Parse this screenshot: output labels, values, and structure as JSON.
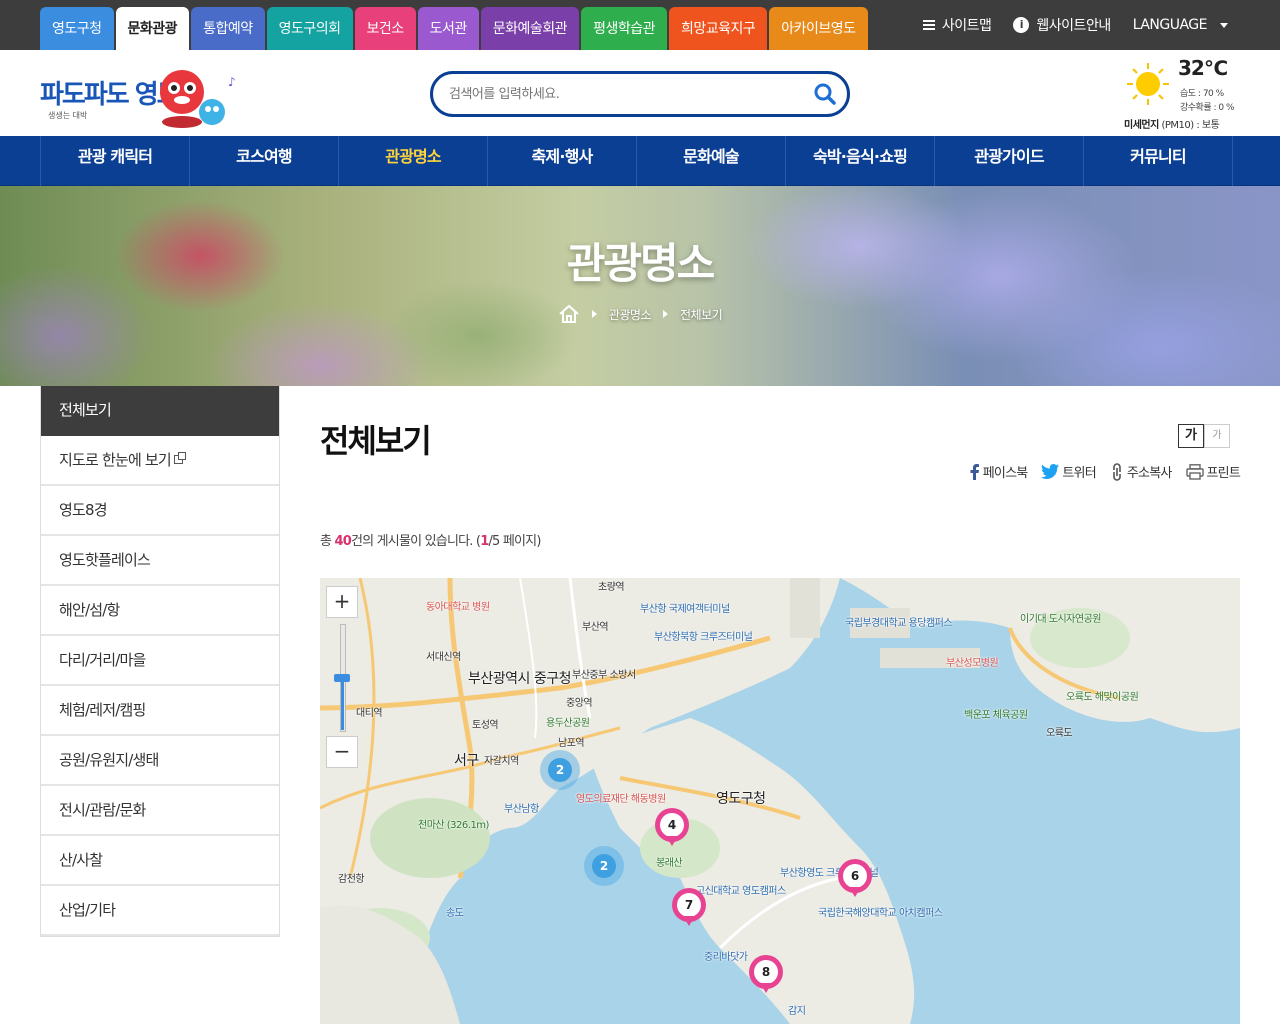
{
  "site_tabs": [
    {
      "label": "영도구청",
      "color": "#3b8de0"
    },
    {
      "label": "문화관광",
      "color": "#ffffff"
    },
    {
      "label": "통합예약",
      "color": "#4a6cc9"
    },
    {
      "label": "영도구의회",
      "color": "#14a3a0"
    },
    {
      "label": "보건소",
      "color": "#e8407a"
    },
    {
      "label": "도서관",
      "color": "#9b59d0"
    },
    {
      "label": "문화예술회관",
      "color": "#7a3fa8"
    },
    {
      "label": "평생학습관",
      "color": "#2eae4d"
    },
    {
      "label": "희망교육지구",
      "color": "#f0541e"
    },
    {
      "label": "아카이브영도",
      "color": "#e88a1a"
    }
  ],
  "util": {
    "sitemap": "사이트맵",
    "guide": "웹사이트안내",
    "language": "LANGUAGE"
  },
  "logo": {
    "text": "파도파도 영도",
    "sub": "생생는 대박"
  },
  "search": {
    "placeholder": "검색어를 입력하세요."
  },
  "weather": {
    "temp": "32℃",
    "humidity": "습도 : 70 %",
    "rain": "강수확률 : 0 %",
    "dust_label": "미세먼지",
    "dust_value": "(PM10) : 보통"
  },
  "gnb": [
    "관광 캐릭터",
    "코스여행",
    "관광명소",
    "축제·행사",
    "문화예술",
    "숙박·음식·쇼핑",
    "관광가이드",
    "커뮤니티"
  ],
  "banner": {
    "title": "관광명소",
    "crumb1": "관광명소",
    "crumb2": "전체보기"
  },
  "lnb": [
    "전체보기",
    "지도로 한눈에 보기",
    "영도8경",
    "영도핫플레이스",
    "해안/섬/항",
    "다리/거리/마을",
    "체험/레저/캠핑",
    "공원/유원지/생태",
    "전시/관람/문화",
    "산/사찰",
    "산업/기타"
  ],
  "content": {
    "title": "전체보기",
    "font_big": "가",
    "font_small": "가",
    "share": {
      "facebook": "페이스북",
      "twitter": "트위터",
      "copy": "주소복사",
      "print": "프린트"
    },
    "count_prefix": "총 ",
    "count_num": "40",
    "count_mid": "건의 게시물이 있습니다. (",
    "count_page": "1",
    "count_suffix": "/5 페이지)"
  },
  "map": {
    "zoom_in": "+",
    "zoom_out": "−",
    "labels": [
      {
        "text": "초량역",
        "cls": ""
      },
      {
        "text": "동아대학교 병원",
        "cls": "red"
      },
      {
        "text": "부산항 국제여객터미널",
        "cls": "blue"
      },
      {
        "text": "부산역",
        "cls": ""
      },
      {
        "text": "부산항북항 크루즈터미널",
        "cls": "blue"
      },
      {
        "text": "국립부경대학교 용당캠퍼스",
        "cls": "blue"
      },
      {
        "text": "이기대 도시자연공원",
        "cls": "green"
      },
      {
        "text": "부산성모병원",
        "cls": "red"
      },
      {
        "text": "서대신역",
        "cls": ""
      },
      {
        "text": "부산광역시 중구청",
        "cls": "big"
      },
      {
        "text": "부산중부 소방서",
        "cls": ""
      },
      {
        "text": "중앙역",
        "cls": ""
      },
      {
        "text": "대티역",
        "cls": ""
      },
      {
        "text": "토성역",
        "cls": ""
      },
      {
        "text": "용두산공원",
        "cls": "green"
      },
      {
        "text": "남포역",
        "cls": ""
      },
      {
        "text": "오륙도 해맞이공원",
        "cls": "green"
      },
      {
        "text": "백운포 체육공원",
        "cls": "green"
      },
      {
        "text": "오륙도",
        "cls": ""
      },
      {
        "text": "서구",
        "cls": "big"
      },
      {
        "text": "자갈치역",
        "cls": ""
      },
      {
        "text": "영도의료재단 해동병원",
        "cls": "red"
      },
      {
        "text": "영도구청",
        "cls": "big"
      },
      {
        "text": "부산남항",
        "cls": "blue"
      },
      {
        "text": "천마산 (326.1m)",
        "cls": "green"
      },
      {
        "text": "봉래산",
        "cls": "green"
      },
      {
        "text": "부산항영도 크루즈터미널",
        "cls": "blue"
      },
      {
        "text": "감천항",
        "cls": ""
      },
      {
        "text": "고신대학교 영도캠퍼스",
        "cls": "blue"
      },
      {
        "text": "국립한국해양대학교 아치캠퍼스",
        "cls": "blue"
      },
      {
        "text": "송도",
        "cls": "blue"
      },
      {
        "text": "중리바닷가",
        "cls": "blue"
      },
      {
        "text": "감지",
        "cls": "blue"
      }
    ],
    "clusters": [
      "2",
      "2"
    ],
    "pins": [
      "4",
      "6",
      "7",
      "8"
    ]
  }
}
